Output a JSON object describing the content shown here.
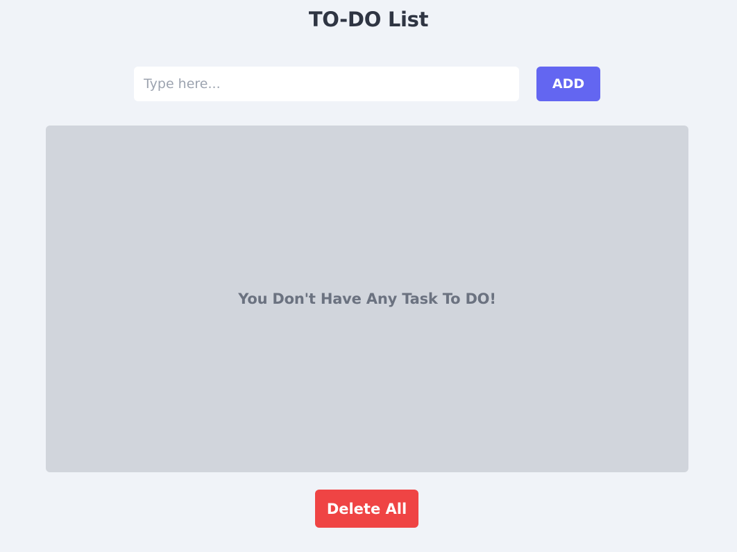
{
  "header": {
    "title": "TO-DO List"
  },
  "task_entry": {
    "placeholder": "Type here...",
    "value": "",
    "add_label": "ADD"
  },
  "task_list": {
    "items": [],
    "empty_message": "You Don't Have Any Task To DO!"
  },
  "footer": {
    "delete_all_label": "Delete All"
  },
  "colors": {
    "background": "#f0f3f8",
    "title_text": "#2f3543",
    "add_button": "#6366f1",
    "panel": "#d1d5dc",
    "empty_text": "#6b7280",
    "delete_button": "#ef4444"
  }
}
